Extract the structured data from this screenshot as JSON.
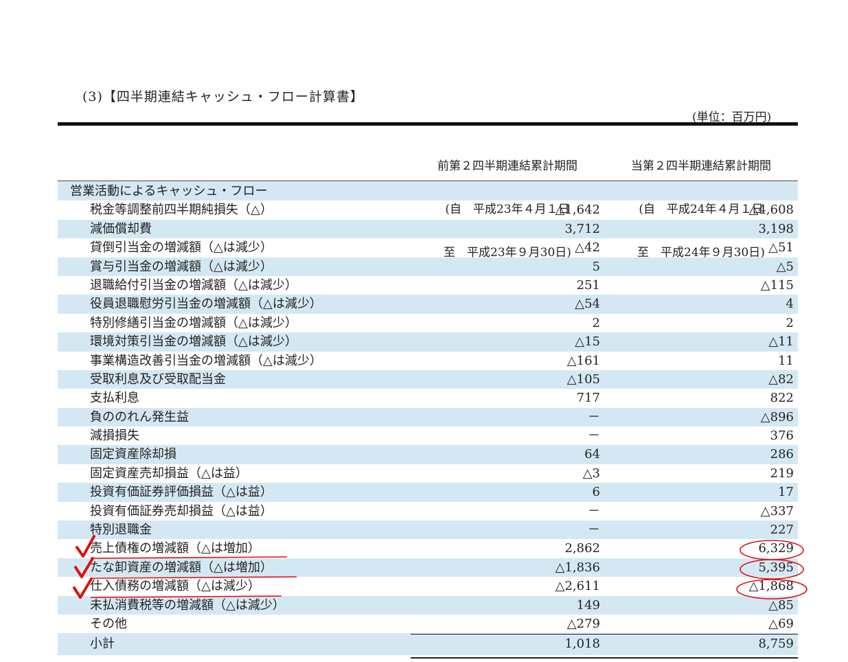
{
  "title": "(3)【四半期連結キャッシュ・フロー計算書】",
  "unit": "(単位：百万円)",
  "columns": {
    "prev": {
      "line1": "前第２四半期連結累計期間",
      "line2": "(自　平成23年４月１日",
      "line3": "至　平成23年９月30日)"
    },
    "curr": {
      "line1": "当第２四半期連結累計期間",
      "line2": "(自　平成24年４月１日",
      "line3": "至　平成24年９月30日)"
    }
  },
  "rows": [
    {
      "label": "営業活動によるキャッシュ・フロー",
      "v1": "",
      "v2": ""
    },
    {
      "label": "税金等調整前四半期純損失（△）",
      "v1": "△1,642",
      "v2": "△4,608"
    },
    {
      "label": "減価償却費",
      "v1": "3,712",
      "v2": "3,198"
    },
    {
      "label": "貸倒引当金の増減額（△は減少）",
      "v1": "△42",
      "v2": "△51"
    },
    {
      "label": "賞与引当金の増減額（△は減少）",
      "v1": "5",
      "v2": "△5"
    },
    {
      "label": "退職給付引当金の増減額（△は減少）",
      "v1": "251",
      "v2": "△115"
    },
    {
      "label": "役員退職慰労引当金の増減額（△は減少）",
      "v1": "△54",
      "v2": "4"
    },
    {
      "label": "特別修繕引当金の増減額（△は減少）",
      "v1": "2",
      "v2": "2"
    },
    {
      "label": "環境対策引当金の増減額（△は減少）",
      "v1": "△15",
      "v2": "△11"
    },
    {
      "label": "事業構造改善引当金の増減額（△は減少）",
      "v1": "△161",
      "v2": "11"
    },
    {
      "label": "受取利息及び受取配当金",
      "v1": "△105",
      "v2": "△82"
    },
    {
      "label": "支払利息",
      "v1": "717",
      "v2": "822"
    },
    {
      "label": "負ののれん発生益",
      "v1": "－",
      "v2": "△896"
    },
    {
      "label": "減損損失",
      "v1": "－",
      "v2": "376"
    },
    {
      "label": "固定資産除却損",
      "v1": "64",
      "v2": "286"
    },
    {
      "label": "固定資産売却損益（△は益）",
      "v1": "△3",
      "v2": "219"
    },
    {
      "label": "投資有価証券評価損益（△は益）",
      "v1": "6",
      "v2": "17"
    },
    {
      "label": "投資有価証券売却損益（△は益）",
      "v1": "－",
      "v2": "△337"
    },
    {
      "label": "特別退職金",
      "v1": "－",
      "v2": "227"
    },
    {
      "label": "売上債権の増減額（△は増加）",
      "v1": "2,862",
      "v2": "6,329"
    },
    {
      "label": "たな卸資産の増減額（△は増加）",
      "v1": "△1,836",
      "v2": "5,395"
    },
    {
      "label": "仕入債務の増減額（△は減少）",
      "v1": "△2,611",
      "v2": "△1,868"
    },
    {
      "label": "未払消費税等の増減額（△は減少）",
      "v1": "149",
      "v2": "△85"
    },
    {
      "label": "その他",
      "v1": "△279",
      "v2": "△69"
    },
    {
      "label": "小計",
      "v1": "1,018",
      "v2": "8,759"
    }
  ],
  "annotations": {
    "color": "#e01010",
    "highlighted_rows": [
      19,
      20,
      21
    ]
  }
}
